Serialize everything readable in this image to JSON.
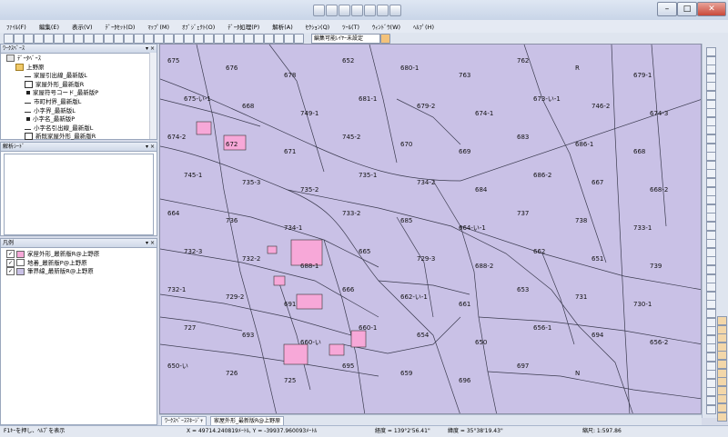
{
  "menu": [
    "ﾌｧｲﾙ(F)",
    "編集(E)",
    "表示(V)",
    "ﾃﾞｰﾀｾｯﾄ(D)",
    "ﾏｯﾌﾟ(M)",
    "ｵﾌﾞｼﾞｪｸﾄ(O)",
    "ﾃﾞｰﾀ処理(P)",
    "解析(A)",
    "ｾｸｼｮﾝ(Q)",
    "ﾂｰﾙ(T)",
    "ｳｨﾝﾄﾞｳ(W)",
    "ﾍﾙﾌﾟ(H)"
  ],
  "toolbar": {
    "layer_select": "編集可能ﾚｲﾔｰ未設定"
  },
  "workspace": {
    "title": "ﾜｰｸｽﾍﾟｰｽ",
    "tree": [
      {
        "label": "ﾃﾞｰﾀﾍﾞｰｽ",
        "level": 0,
        "symbol": "db"
      },
      {
        "label": "上野原",
        "level": 1,
        "symbol": "folder"
      },
      {
        "label": "家屋引出線_最新版L",
        "level": 2,
        "symbol": "line"
      },
      {
        "label": "家屋外形_最新版R",
        "level": 2,
        "symbol": "poly"
      },
      {
        "label": "家屋符号コード_最新版P",
        "level": 2,
        "symbol": "point"
      },
      {
        "label": "市町村界_最新版L",
        "level": 2,
        "symbol": "line"
      },
      {
        "label": "小字界_最新版L",
        "level": 2,
        "symbol": "line"
      },
      {
        "label": "小字名_最新版P",
        "level": 2,
        "symbol": "point"
      },
      {
        "label": "小字名引出線_最新版L",
        "level": 2,
        "symbol": "line"
      },
      {
        "label": "新既家屋外形_最新版R",
        "level": 2,
        "symbol": "poly"
      }
    ]
  },
  "analysis": {
    "title": "解析ｼｰﾄﾞ"
  },
  "legend": {
    "title": "凡例",
    "items": [
      {
        "label": "家屋外形_最新版R@上野原",
        "checked": true,
        "color": "#f7a8d8"
      },
      {
        "label": "地番_最新版P@上野原",
        "checked": true,
        "color": "#ffffff"
      },
      {
        "label": "筆界線_最新版R@上野原",
        "checked": true,
        "color": "#c9c1e6"
      }
    ]
  },
  "tabs": [
    "ﾜｰｸｽﾍﾟｰｽﾏﾈｰｼﾞｬ",
    "家屋外形_最新版R@上野原"
  ],
  "status": {
    "hint": "F1ｷｰを押し、ﾍﾙﾌﾟを表示",
    "xy": "X = 49714.240819ﾒｰﾄﾙ, Y = -39937.960093ﾒｰﾄﾙ",
    "lon": "経度 = 139°2'56.41\"",
    "lat": "緯度 = 35°38'19.43\"",
    "scale": "縮尺: 1:597.86"
  },
  "colors": {
    "parcel_fill": "#c9c1e6",
    "house_fill": "#f7a8d8",
    "line": "#3b3b4f"
  },
  "parcels": [
    "675",
    "676",
    "678",
    "652",
    "680-1",
    "763",
    "762",
    "R",
    "679-1",
    "675-い-1",
    "668",
    "749-1",
    "681-1",
    "679-2",
    "674-1",
    "673-い-1",
    "746-2",
    "674-3",
    "674-2",
    "672",
    "671",
    "745-2",
    "670",
    "669",
    "683",
    "686-1",
    "668",
    "745-1",
    "735-3",
    "735-2",
    "735-1",
    "734-2",
    "684",
    "686-2",
    "667",
    "668-2",
    "664",
    "736",
    "734-1",
    "733-2",
    "685",
    "664-い-1",
    "737",
    "738",
    "733-1",
    "732-3",
    "732-2",
    "688-1",
    "665",
    "729-3",
    "688-2",
    "662",
    "651",
    "739",
    "732-1",
    "729-2",
    "691",
    "666",
    "662-い-1",
    "661",
    "653",
    "731",
    "730-1",
    "727",
    "693",
    "660-い",
    "660-1",
    "654",
    "650",
    "656-1",
    "694",
    "656-2",
    "650-い",
    "726",
    "725",
    "695",
    "659",
    "696",
    "697",
    "N"
  ]
}
